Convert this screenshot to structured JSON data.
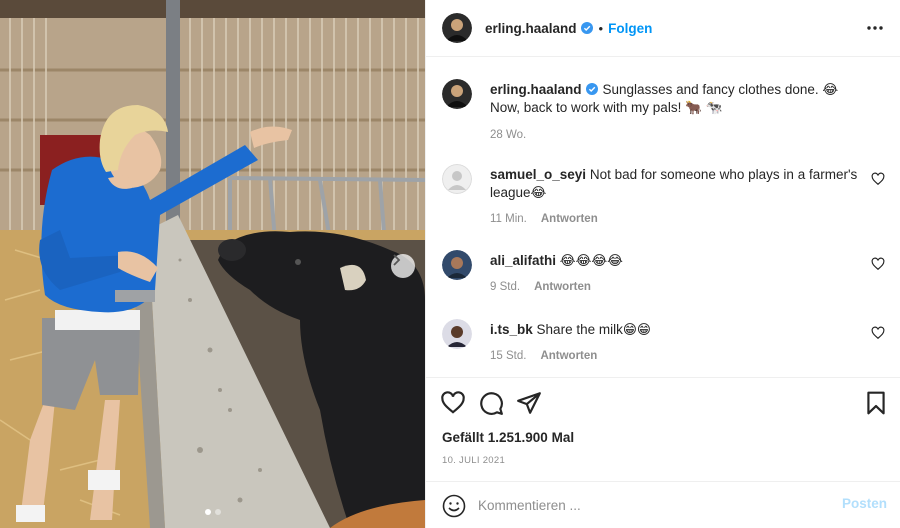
{
  "post": {
    "author": "erling.haaland",
    "follow_label": "Folgen",
    "separator": "•",
    "caption_text": "Sunglasses and fancy clothes done. 😂 Now, back to work with my pals! 🐂 🐄",
    "caption_time": "28 Wo."
  },
  "comments": [
    {
      "user": "samuel_o_seyi",
      "text": "Not bad for someone who plays in a farmer's league😂",
      "time": "11 Min.",
      "reply": "Antworten"
    },
    {
      "user": "ali_alifathi",
      "text": "😂😂😂😂",
      "time": "9 Std.",
      "reply": "Antworten"
    },
    {
      "user": "i.ts_bk",
      "text": "Share the milk😁😁",
      "time": "15 Std.",
      "reply": "Antworten"
    }
  ],
  "likes": "Gefällt 1.251.900 Mal",
  "date": "10. JULI 2021",
  "composer": {
    "placeholder": "Kommentieren ...",
    "post_label": "Posten"
  },
  "carousel": {
    "total": 2,
    "active": 1
  },
  "colors": {
    "link": "#0095f6",
    "muted": "#8e8e8e",
    "post_disabled": "#b2dffc",
    "verified": "#3897f0"
  },
  "icons": [
    "verified-badge-icon",
    "more-icon",
    "heart-icon",
    "comment-icon",
    "share-icon",
    "bookmark-icon",
    "emoji-icon",
    "chevron-right-icon"
  ]
}
